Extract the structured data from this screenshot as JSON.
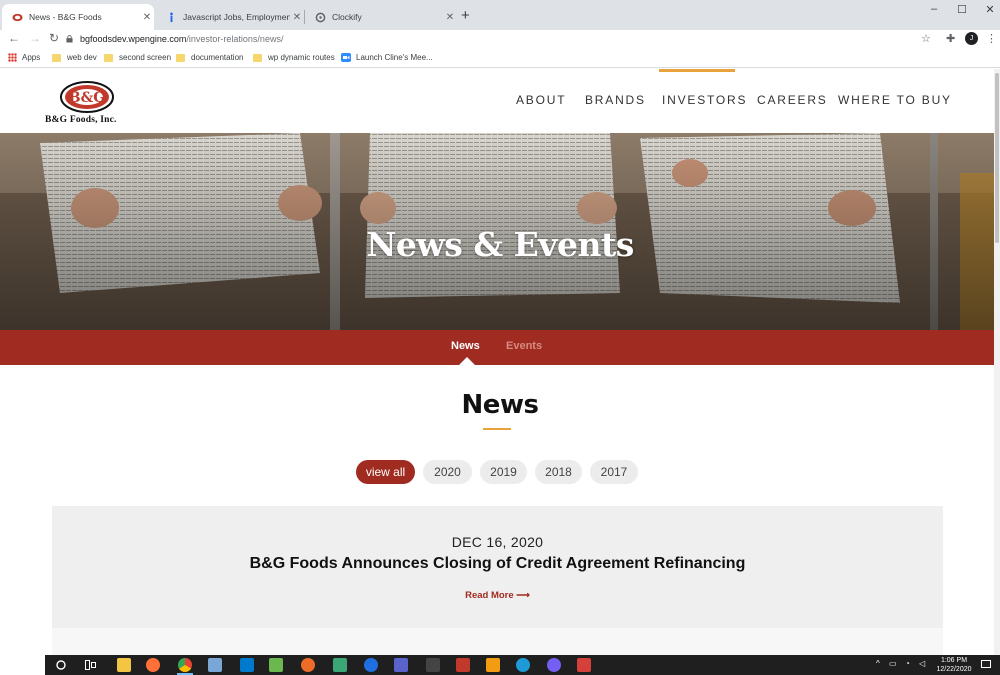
{
  "browser": {
    "tabs": [
      {
        "title": "News - B&G Foods",
        "active": true,
        "icon": "bg-foods-favicon"
      },
      {
        "title": "Javascript Jobs, Employment in S",
        "active": false,
        "icon": "indeed-favicon"
      },
      {
        "title": "Clockify",
        "active": false,
        "icon": "clockify-favicon"
      }
    ],
    "new_tab": "+",
    "window_controls": {
      "minimize": "–",
      "maximize": "☐",
      "close": "✕"
    },
    "url_host": "bgfoodsdev.wpengine.com",
    "url_path": "/investor-relations/news/",
    "profile_initial": "J",
    "bookmarks": [
      {
        "label": "Apps",
        "icon": "apps-grid-icon"
      },
      {
        "label": "web dev",
        "icon": "folder-icon"
      },
      {
        "label": "second screen",
        "icon": "folder-icon"
      },
      {
        "label": "documentation",
        "icon": "folder-icon"
      },
      {
        "label": "wp dynamic routes",
        "icon": "folder-icon"
      },
      {
        "label": "Launch Cline's Mee...",
        "icon": "zoom-icon"
      }
    ]
  },
  "site": {
    "logo_text": "B&G Foods, Inc.",
    "nav": [
      {
        "label": "ABOUT"
      },
      {
        "label": "BRANDS"
      },
      {
        "label": "INVESTORS",
        "active": true
      },
      {
        "label": "CAREERS"
      },
      {
        "label": "WHERE TO BUY"
      }
    ],
    "accent": "#e8a33d",
    "brand_red": "#a02b20"
  },
  "hero": {
    "title": "News & Events"
  },
  "subnav": {
    "items": [
      {
        "label": "News",
        "active": true
      },
      {
        "label": "Events",
        "active": false
      }
    ]
  },
  "main": {
    "title": "News",
    "filters": [
      {
        "label": "view all",
        "active": true
      },
      {
        "label": "2020"
      },
      {
        "label": "2019"
      },
      {
        "label": "2018"
      },
      {
        "label": "2017"
      }
    ],
    "articles": [
      {
        "date": "DEC 16, 2020",
        "title": "B&G Foods Announces Closing of Credit Agreement Refinancing",
        "link": "Read More ⟶"
      }
    ]
  },
  "taskbar": {
    "clock_time": "1:06 PM",
    "clock_date": "12/22/2020"
  }
}
